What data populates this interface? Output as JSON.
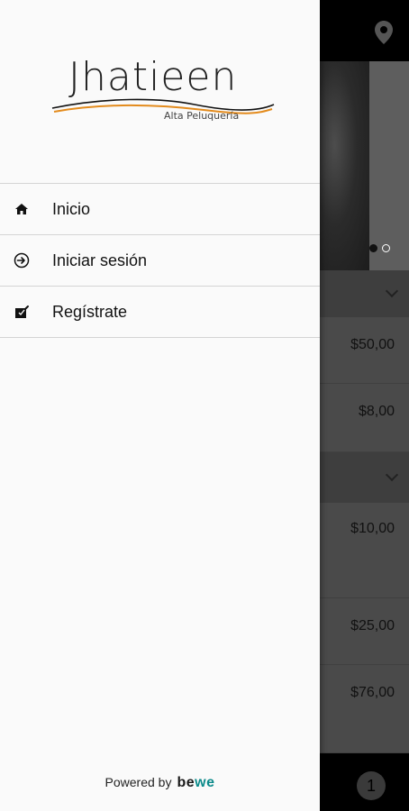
{
  "drawer": {
    "brand_name": "Jhatieen",
    "brand_tagline": "Alta Peluquería",
    "menu": [
      {
        "label": "Inicio",
        "icon": "home-icon"
      },
      {
        "label": "Iniciar sesión",
        "icon": "login-icon"
      },
      {
        "label": "Regístrate",
        "icon": "register-icon"
      }
    ],
    "footer": {
      "powered_by": "Powered by",
      "brand_prefix": "be",
      "brand_suffix": "we"
    }
  },
  "background": {
    "prices": [
      "$50,00",
      "$8,00",
      "$10,00",
      "$25,00",
      "$76,00"
    ],
    "cart_count": "1",
    "carousel": {
      "total": 2,
      "active": 1
    }
  },
  "colors": {
    "accent": "#e38b1d",
    "bewe_accent": "#0b8a8a",
    "drawer_bg": "#fafafa",
    "topbar": "#000000"
  }
}
